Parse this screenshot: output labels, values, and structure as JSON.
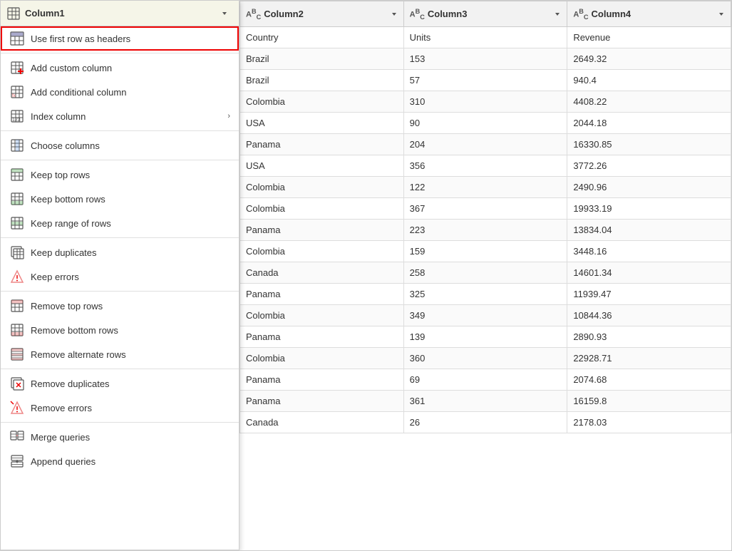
{
  "header": {
    "column1": "Column1",
    "column1_icon": "ABC",
    "dropdown_arrow": "▾"
  },
  "menu": {
    "items": [
      {
        "id": "use-first-row",
        "label": "Use first row as headers",
        "icon": "table-header",
        "highlighted": true,
        "hasArrow": false
      },
      {
        "id": "divider1",
        "type": "divider"
      },
      {
        "id": "add-custom-column",
        "label": "Add custom column",
        "icon": "custom-col",
        "highlighted": false,
        "hasArrow": false
      },
      {
        "id": "add-conditional-column",
        "label": "Add conditional column",
        "icon": "conditional-col",
        "highlighted": false,
        "hasArrow": false
      },
      {
        "id": "index-column",
        "label": "Index column",
        "icon": "index-col",
        "highlighted": false,
        "hasArrow": true
      },
      {
        "id": "divider2",
        "type": "divider"
      },
      {
        "id": "choose-columns",
        "label": "Choose columns",
        "icon": "choose-col",
        "highlighted": false,
        "hasArrow": false
      },
      {
        "id": "divider3",
        "type": "divider"
      },
      {
        "id": "keep-top-rows",
        "label": "Keep top rows",
        "icon": "keep-top",
        "highlighted": false,
        "hasArrow": false
      },
      {
        "id": "keep-bottom-rows",
        "label": "Keep bottom rows",
        "icon": "keep-bottom",
        "highlighted": false,
        "hasArrow": false
      },
      {
        "id": "keep-range-of-rows",
        "label": "Keep range of rows",
        "icon": "keep-range",
        "highlighted": false,
        "hasArrow": false
      },
      {
        "id": "divider4",
        "type": "divider"
      },
      {
        "id": "keep-duplicates",
        "label": "Keep duplicates",
        "icon": "keep-dup",
        "highlighted": false,
        "hasArrow": false
      },
      {
        "id": "keep-errors",
        "label": "Keep errors",
        "icon": "keep-err",
        "highlighted": false,
        "hasArrow": false
      },
      {
        "id": "divider5",
        "type": "divider"
      },
      {
        "id": "remove-top-rows",
        "label": "Remove top rows",
        "icon": "remove-top",
        "highlighted": false,
        "hasArrow": false
      },
      {
        "id": "remove-bottom-rows",
        "label": "Remove bottom rows",
        "icon": "remove-bottom",
        "highlighted": false,
        "hasArrow": false
      },
      {
        "id": "remove-alternate-rows",
        "label": "Remove alternate rows",
        "icon": "remove-alt",
        "highlighted": false,
        "hasArrow": false
      },
      {
        "id": "divider6",
        "type": "divider"
      },
      {
        "id": "remove-duplicates",
        "label": "Remove duplicates",
        "icon": "remove-dup",
        "highlighted": false,
        "hasArrow": false
      },
      {
        "id": "remove-errors",
        "label": "Remove errors",
        "icon": "remove-err",
        "highlighted": false,
        "hasArrow": false
      },
      {
        "id": "divider7",
        "type": "divider"
      },
      {
        "id": "merge-queries",
        "label": "Merge queries",
        "icon": "merge",
        "highlighted": false,
        "hasArrow": false
      },
      {
        "id": "append-queries",
        "label": "Append queries",
        "icon": "append",
        "highlighted": false,
        "hasArrow": false
      }
    ]
  },
  "table": {
    "columns": [
      {
        "id": "col2",
        "name": "Column2",
        "icon": "ABC"
      },
      {
        "id": "col3",
        "name": "Column3",
        "icon": "ABC"
      },
      {
        "id": "col4",
        "name": "Column4",
        "icon": "ABC"
      }
    ],
    "rows": [
      [
        "Country",
        "Units",
        "Revenue"
      ],
      [
        "Brazil",
        "153",
        "2649.32"
      ],
      [
        "Brazil",
        "57",
        "940.4"
      ],
      [
        "Colombia",
        "310",
        "4408.22"
      ],
      [
        "USA",
        "90",
        "2044.18"
      ],
      [
        "Panama",
        "204",
        "16330.85"
      ],
      [
        "USA",
        "356",
        "3772.26"
      ],
      [
        "Colombia",
        "122",
        "2490.96"
      ],
      [
        "Colombia",
        "367",
        "19933.19"
      ],
      [
        "Panama",
        "223",
        "13834.04"
      ],
      [
        "Colombia",
        "159",
        "3448.16"
      ],
      [
        "Canada",
        "258",
        "14601.34"
      ],
      [
        "Panama",
        "325",
        "11939.47"
      ],
      [
        "Colombia",
        "349",
        "10844.36"
      ],
      [
        "Panama",
        "139",
        "2890.93"
      ],
      [
        "Colombia",
        "360",
        "22928.71"
      ],
      [
        "Panama",
        "69",
        "2074.68"
      ],
      [
        "Panama",
        "361",
        "16159.8"
      ],
      [
        "Canada",
        "26",
        "2178.03"
      ]
    ]
  }
}
